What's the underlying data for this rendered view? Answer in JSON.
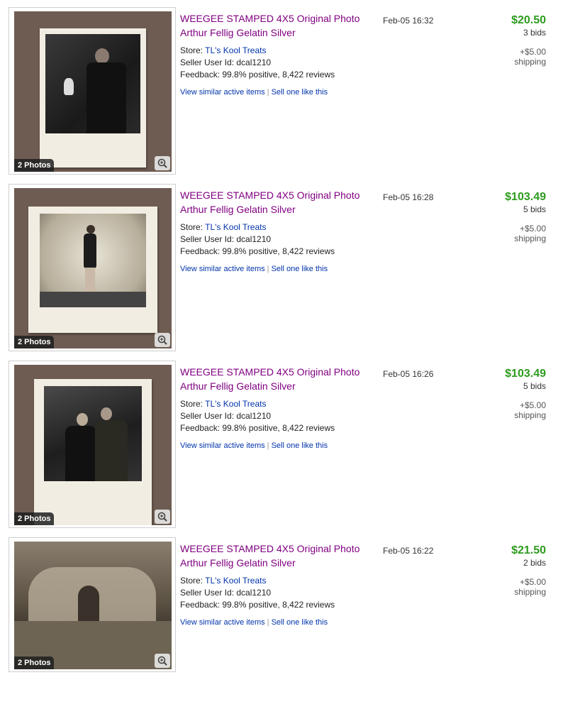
{
  "listings": [
    {
      "title_line1": "WEEGEE STAMPED 4X5 Original Photo",
      "title_line2": "Arthur Fellig Gelatin Silver",
      "store_label": "Store:",
      "store_name": "TL's Kool Treats",
      "seller": "Seller User Id: dcal1210",
      "feedback": "Feedback: 99.8% positive, 8,422 reviews",
      "link_similar": "View similar active items",
      "link_sep": "|",
      "link_sell": "Sell one like this",
      "photos_badge": "2 Photos",
      "date": "Feb-05 16:32",
      "price": "$20.50",
      "bids": "3 bids",
      "shipping_cost": "+$5.00",
      "shipping_label": "shipping",
      "photo_icon": "zoom-magnifier-icon"
    },
    {
      "title_line1": "WEEGEE STAMPED 4X5 Original Photo",
      "title_line2": "Arthur Fellig Gelatin Silver",
      "store_label": "Store:",
      "store_name": "TL's Kool Treats",
      "seller": "Seller User Id: dcal1210",
      "feedback": "Feedback: 99.8% positive, 8,422 reviews",
      "link_similar": "View similar active items",
      "link_sep": "|",
      "link_sell": "Sell one like this",
      "photos_badge": "2 Photos",
      "date": "Feb-05 16:28",
      "price": "$103.49",
      "bids": "5 bids",
      "shipping_cost": "+$5.00",
      "shipping_label": "shipping",
      "photo_icon": "zoom-magnifier-icon"
    },
    {
      "title_line1": "WEEGEE STAMPED 4X5 Original Photo",
      "title_line2": "Arthur Fellig Gelatin Silver",
      "store_label": "Store:",
      "store_name": "TL's Kool Treats",
      "seller": "Seller User Id: dcal1210",
      "feedback": "Feedback: 99.8% positive, 8,422 reviews",
      "link_similar": "View similar active items",
      "link_sep": "|",
      "link_sell": "Sell one like this",
      "photos_badge": "2 Photos",
      "date": "Feb-05 16:26",
      "price": "$103.49",
      "bids": "5 bids",
      "shipping_cost": "+$5.00",
      "shipping_label": "shipping",
      "photo_icon": "zoom-magnifier-icon"
    },
    {
      "title_line1": "WEEGEE STAMPED 4X5 Original Photo",
      "title_line2": "Arthur Fellig Gelatin Silver",
      "store_label": "Store:",
      "store_name": "TL's Kool Treats",
      "seller": "Seller User Id: dcal1210",
      "feedback": "Feedback: 99.8% positive, 8,422 reviews",
      "link_similar": "View similar active items",
      "link_sep": "|",
      "link_sell": "Sell one like this",
      "photos_badge": "2 Photos",
      "date": "Feb-05 16:22",
      "price": "$21.50",
      "bids": "2 bids",
      "shipping_cost": "+$5.00",
      "shipping_label": "shipping",
      "photo_icon": "zoom-magnifier-icon"
    }
  ],
  "colors": {
    "title": "#800080",
    "link": "#0033aa",
    "price": "#2d9b1e"
  }
}
